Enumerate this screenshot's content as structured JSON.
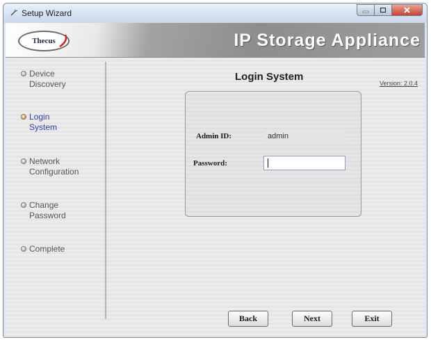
{
  "window": {
    "title": "Setup Wizard",
    "controls": [
      "minimize-icon",
      "maximize-icon",
      "close-icon"
    ]
  },
  "banner": {
    "logo_text": "Thecus",
    "title": "IP Storage Appliance"
  },
  "sidebar": {
    "steps": [
      {
        "line1": "Device",
        "line2": "Discovery",
        "active": false
      },
      {
        "line1": "Login",
        "line2": "System",
        "active": true
      },
      {
        "line1": "Network",
        "line2": "Configuration",
        "active": false
      },
      {
        "line1": "Change",
        "line2": "Password",
        "active": false
      },
      {
        "line1": "Complete",
        "line2": "",
        "active": false
      }
    ]
  },
  "main": {
    "heading": "Login System",
    "version": "Version: 2.0.4",
    "admin_label": "Admin ID:",
    "admin_value": "admin",
    "password_label": "Password:",
    "password_value": ""
  },
  "buttons": {
    "back": "Back",
    "next": "Next",
    "exit": "Exit"
  },
  "colors": {
    "active_step": "#2e3fa8",
    "inactive_step": "#555555",
    "banner_text": "#ffffff"
  }
}
